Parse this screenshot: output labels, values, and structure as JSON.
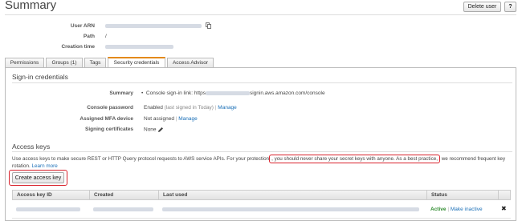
{
  "page": {
    "title": "Summary"
  },
  "header_buttons": {
    "delete_user": "Delete user",
    "help": "?"
  },
  "summary_fields": {
    "user_arn_label": "User ARN",
    "path_label": "Path",
    "path_value": "/",
    "creation_time_label": "Creation time"
  },
  "tabs": [
    {
      "label": "Permissions"
    },
    {
      "label": "Groups (1)"
    },
    {
      "label": "Tags"
    },
    {
      "label": "Security credentials"
    },
    {
      "label": "Access Advisor"
    }
  ],
  "signin": {
    "heading": "Sign-in credentials",
    "summary_label": "Summary",
    "summary_prefix": "Console sign-in link: https",
    "summary_suffix": "signin.aws.amazon.com/console",
    "console_password_label": "Console password",
    "console_password_value": "Enabled",
    "console_password_note": "(last signed in Today)",
    "manage_link": "Manage",
    "mfa_label": "Assigned MFA device",
    "mfa_value": "Not assigned",
    "mfa_manage": "Manage",
    "signing_label": "Signing certificates",
    "signing_value": "None"
  },
  "access_keys": {
    "heading": "Access keys",
    "desc_part1": "Use access keys to make secure REST or HTTP Query protocol requests to AWS service APIs. For your protection",
    "desc_highlight": ", you should never share your secret keys with anyone. As a best practice,",
    "desc_part2": "we recommend frequent key",
    "desc_line2": "rotation.",
    "learn_more": "Learn more",
    "create_button": "Create access key",
    "columns": [
      "Access key ID",
      "Created",
      "Last used",
      "Status"
    ],
    "row": {
      "status": "Active",
      "make_inactive": "Make inactive",
      "delete_icon": "✖"
    }
  },
  "colors": {
    "accent": "#e48a1b",
    "link": "#1a6fb7",
    "highlight": "#d9232d",
    "active": "#2e8b2e"
  }
}
